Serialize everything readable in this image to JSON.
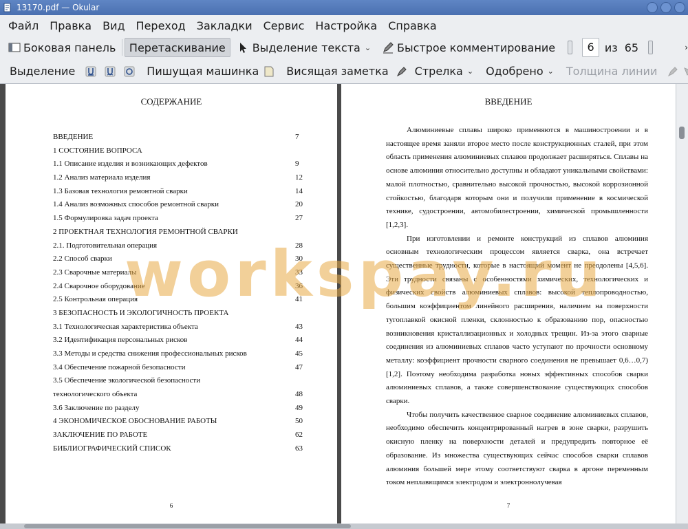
{
  "window": {
    "title": "13170.pdf  — Okular"
  },
  "menu": [
    "Файл",
    "Правка",
    "Вид",
    "Переход",
    "Закладки",
    "Сервис",
    "Настройка",
    "Справка"
  ],
  "toolbar1": {
    "sidebar_label": "Боковая панель",
    "browse_label": "Перетаскивание",
    "text_select_label": "Выделение текста",
    "quick_annot_label": "Быстрое комментирование",
    "page_current": "6",
    "page_of": "из",
    "page_total": "65"
  },
  "toolbar2": {
    "highlight_label": "Выделение",
    "typewriter_label": "Пишущая машинка",
    "note_label": "Висящая заметка",
    "arrow_label": "Стрелка",
    "stamp_label": "Одобрено",
    "line_width_label": "Толщина линии"
  },
  "icons": [
    "app-icon",
    "sidebar-icon",
    "cursor-icon",
    "pencil-icon",
    "underline-icon",
    "squiggle-icon",
    "stamp-icon",
    "note-icon",
    "arrow-icon",
    "line-width-icon",
    "shape-icon"
  ],
  "watermark": "workspay.ru",
  "left_page": {
    "heading": "СОДЕРЖАНИЕ",
    "toc": [
      {
        "text": "ВВЕДЕНИЕ",
        "page": "7"
      },
      {
        "text": "1 СОСТОЯНИЕ ВОПРОСА",
        "page": ""
      },
      {
        "text": "1.1 Описание изделия и возникающих дефектов",
        "page": "9"
      },
      {
        "text": "1.2 Анализ материала изделия",
        "page": "12"
      },
      {
        "text": "1.3 Базовая технология ремонтной сварки",
        "page": "14"
      },
      {
        "text": "1.4 Анализ возможных способов ремонтной сварки",
        "page": "20"
      },
      {
        "text": "1.5 Формулировка задач проекта",
        "page": "27"
      },
      {
        "text": "2 ПРОЕКТНАЯ ТЕХНОЛОГИЯ РЕМОНТНОЙ СВАРКИ",
        "page": ""
      },
      {
        "text": "2.1. Подготовительная операция",
        "page": "28"
      },
      {
        "text": "2.2 Способ сварки",
        "page": "30"
      },
      {
        "text": "2.3 Сварочные материалы",
        "page": "33"
      },
      {
        "text": "2.4 Сварочное оборудование",
        "page": "36"
      },
      {
        "text": "2.5 Контрольная операция",
        "page": "41"
      },
      {
        "text": "3 БЕЗОПАСНОСТЬ И ЭКОЛОГИЧНОСТЬ ПРОЕКТА",
        "page": ""
      },
      {
        "text": "3.1 Технологическая характеристика объекта",
        "page": "43"
      },
      {
        "text": "3.2 Идентификация персональных рисков",
        "page": "44"
      },
      {
        "text": "3.3 Методы и средства снижения профессиональных рисков",
        "page": "45"
      },
      {
        "text": "3.4 Обеспечение пожарной безопасности",
        "page": "47"
      },
      {
        "text": "3.5 Обеспечение экологической безопасности",
        "page": ""
      },
      {
        "text": "технологического объекта",
        "page": "48"
      },
      {
        "text": "3.6 Заключение по разделу",
        "page": "49"
      },
      {
        "text": "4 ЭКОНОМИЧЕСКОЕ ОБОСНОВАНИЕ РАБОТЫ",
        "page": "50"
      },
      {
        "text": "ЗАКЛЮЧЕНИЕ ПО РАБОТЕ",
        "page": "62"
      },
      {
        "text": "БИБЛИОГРАФИЧЕСКИЙ СПИСОК",
        "page": "63"
      }
    ],
    "page_number": "6"
  },
  "right_page": {
    "heading": "ВВЕДЕНИЕ",
    "paragraphs": [
      "Алюминиевые сплавы широко применяются в машиностроении и в настоящее время заняли второе место после конструкционных сталей, при этом область применения алюминиевых сплавов продолжает расширяться. Сплавы на основе алюминия относительно доступны и обладают уникальными свойствами: малой плотностью, сравнительно высокой прочностью, высокой коррозионной стойкостью, благодаря которым они и получили применение в космической технике, судостроении, автомобилестроении, химической промышленности [1,2,3].",
      "При изготовлении и ремонте конструкций из сплавов алюминия основным технологическим процессом является сварка, она встречает существенные трудности, которые в настоящий момент не преодолены [4,5,6]. Эти трудности связаны с особенностями химических, технологических и физических свойств алюминиевых сплавов: высокой теплопроводностью, большим коэффициентом линейного расширения, наличием на поверхности тугоплавкой окисной пленки, склонностью к образованию пор, опасностью возникновения кристаллизационных и холодных трещин. Из-за этого сварные соединения из алюминиевых сплавов часто уступают по прочности основному металлу: коэффициент прочности сварного соединения не превышает 0,6…0,7) [1,2]. Поэтому необходима разработка новых эффективных способов сварки алюминиевых сплавов, а также совершенствование существующих способов сварки.",
      "Чтобы получить качественное сварное соединение алюминиевых сплавов, необходимо обеспечить концентрированный нагрев в зоне сварки, разрушить окисную пленку на поверхности деталей и предупредить повторное её образование. Из множества существующих сейчас способов сварки сплавов алюминия большей мере этому соответствуют сварка в аргоне переменным током неплавящимся электродом и электроннолучевая"
    ],
    "page_number": "7"
  }
}
